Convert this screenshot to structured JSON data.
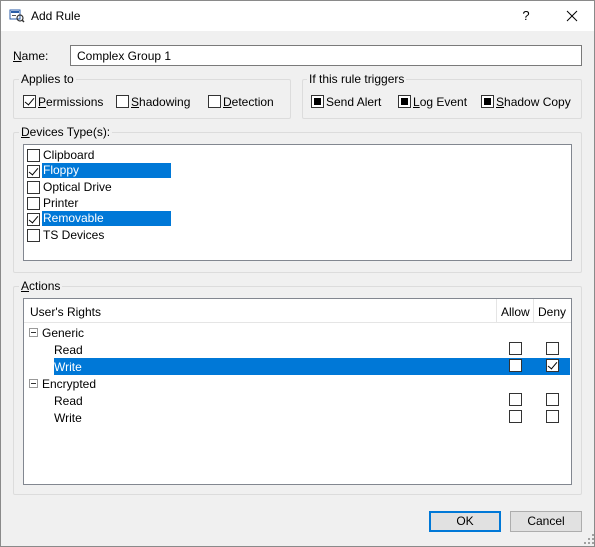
{
  "window": {
    "title": "Add Rule",
    "help": "?"
  },
  "name_field": {
    "label": "Name:",
    "value": "Complex Group 1"
  },
  "applies_to": {
    "label": "Applies to",
    "items": [
      {
        "label": "Permissions",
        "checked": true
      },
      {
        "label": "Shadowing",
        "checked": false
      },
      {
        "label": "Detection",
        "checked": false
      }
    ]
  },
  "triggers": {
    "label": "If this rule triggers",
    "items": [
      {
        "label": "Send Alert",
        "checked": true
      },
      {
        "label": "Log Event",
        "checked": true
      },
      {
        "label": "Shadow Copy",
        "checked": true
      }
    ]
  },
  "device_types": {
    "label": "Devices Type(s):",
    "items": [
      {
        "label": "Clipboard",
        "checked": false,
        "selected": false
      },
      {
        "label": "Floppy",
        "checked": true,
        "selected": true
      },
      {
        "label": "Optical Drive",
        "checked": false,
        "selected": false
      },
      {
        "label": "Printer",
        "checked": false,
        "selected": false
      },
      {
        "label": "Removable",
        "checked": true,
        "selected": true
      },
      {
        "label": "TS Devices",
        "checked": false,
        "selected": false
      }
    ]
  },
  "actions": {
    "label": "Actions",
    "columns": {
      "rights": "User's Rights",
      "allow": "Allow",
      "deny": "Deny"
    },
    "groups": [
      {
        "name": "Generic",
        "rows": [
          {
            "label": "Read",
            "allow": false,
            "deny": false,
            "selected": false
          },
          {
            "label": "Write",
            "allow": false,
            "deny": true,
            "selected": true
          }
        ]
      },
      {
        "name": "Encrypted",
        "rows": [
          {
            "label": "Read",
            "allow": false,
            "deny": false,
            "selected": false
          },
          {
            "label": "Write",
            "allow": false,
            "deny": false,
            "selected": false
          }
        ]
      }
    ]
  },
  "buttons": {
    "ok": "OK",
    "cancel": "Cancel"
  },
  "icons": {
    "app": "rule-icon",
    "close": "close-icon",
    "collapse": "minus-box-icon",
    "grip": "resize-grip-icon"
  },
  "colors": {
    "selection": "#0078d7",
    "dialog_bg": "#f0f0f0"
  }
}
